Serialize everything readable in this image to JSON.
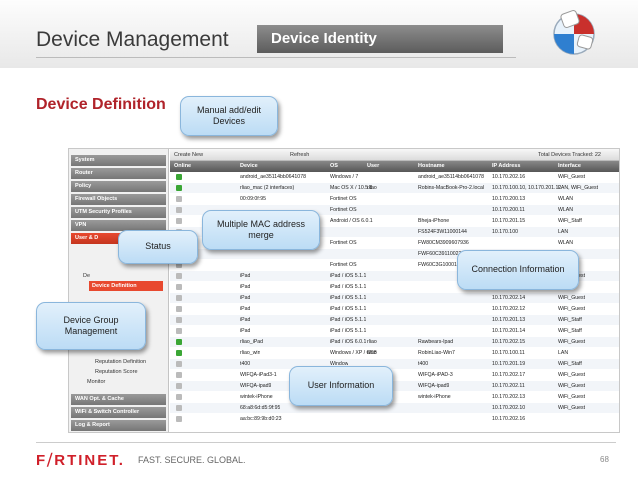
{
  "header": {
    "title": "Device Management",
    "tab": "Device Identity"
  },
  "subtitle": "Device Definition",
  "toolbar": {
    "create": "Create New",
    "refresh": "Refresh",
    "total": "Total Devices Tracked: 22"
  },
  "sidebar": {
    "sections": [
      "System",
      "Router",
      "Policy",
      "Firewall Objects",
      "UTM Security Profiles",
      "VPN",
      "User & D"
    ],
    "tree": [
      "De",
      "Device Definition",
      "Reputation Definition",
      "Reputation Score",
      "Monitor"
    ],
    "bottom": [
      "WAN Opt. & Cache",
      "WiFi & Switch Controller",
      "Log & Report"
    ]
  },
  "columns": [
    "Online",
    "Device",
    "OS",
    "User",
    "Hostname",
    "IP Address",
    "Interface"
  ],
  "rows": [
    [
      "android_ae35114bb0641078",
      "Windows / 7",
      "",
      "android_ae35114bb0641078",
      "10.170.202.16",
      "WiFi_Guest"
    ],
    [
      "rliao_mac (2 interfaces)",
      "Mac OS X / 10.5.8",
      "rliao",
      "Robins-MacBook-Pro-2.local",
      "10.170.100.10, 10.170.201.12",
      "LAN, WiFi_Guest"
    ],
    [
      "00:09:0f:95",
      "Fortinet OS",
      "",
      "",
      "10.170.200.13",
      "WLAN"
    ],
    [
      "",
      "Fortinet OS",
      "",
      "",
      "10.170.200.11",
      "WLAN"
    ],
    [
      "",
      "Android / OS 6.0.1",
      "",
      "Bheja-iPhone",
      "10.170.201.15",
      "WiFi_Staff"
    ],
    [
      "",
      "",
      "",
      "FS524F3W11000144",
      "10.170.100",
      "LAN"
    ],
    [
      "",
      "Fortinet OS",
      "",
      "FW80CM3909607936",
      "",
      "WLAN"
    ],
    [
      "",
      "",
      "",
      "FWF60C3911002282",
      "",
      "LAN"
    ],
    [
      "",
      "Fortinet OS",
      "",
      "FW60C3G10001095",
      "",
      "LAN"
    ],
    [
      "iPad",
      "iPad / iOS 5.1.1",
      "",
      "",
      "",
      "WiFi_Guest"
    ],
    [
      "iPad",
      "iPad / iOS 5.1.1",
      "",
      "",
      "",
      ""
    ],
    [
      "iPad",
      "iPad / iOS 5.1.1",
      "",
      "",
      "10.170.202.14",
      "WiFi_Guest"
    ],
    [
      "iPad",
      "iPad / iOS 5.1.1",
      "",
      "",
      "10.170.202.12",
      "WiFi_Guest"
    ],
    [
      "iPad",
      "iPad / iOS 5.1.1",
      "",
      "",
      "10.170.201.13",
      "WiFi_Staff"
    ],
    [
      "iPad",
      "iPad / iOS 5.1.1",
      "",
      "",
      "10.170.201.14",
      "WiFi_Staff"
    ],
    [
      "rliao_iPad",
      "iPad / iOS 6.0.1",
      "rliao",
      "Rawbears-Ipad",
      "10.170.202.15",
      "WiFi_Guest"
    ],
    [
      "rliao_win",
      "Windows / XP / 6/98",
      "rliao",
      "RobinLiao-Win7",
      "10.170.100.11",
      "LAN"
    ],
    [
      "t400",
      "Window",
      "",
      "t400",
      "10.170.201.19",
      "WiFi_Staff"
    ],
    [
      "WIFQA-iPad3-1",
      "",
      "",
      "WIFQA-iPAD-3",
      "10.170.202.17",
      "WiFi_Guest"
    ],
    [
      "WIFQA-ipad9",
      "",
      "",
      "WIFQA-ipad9",
      "10.170.202.11",
      "WiFi_Guest"
    ],
    [
      "wintek-iPhone",
      "",
      "",
      "wintek-iPhone",
      "10.170.202.13",
      "WiFi_Guest"
    ],
    [
      "68:a8:6d:d5:9f:95",
      "",
      "",
      "",
      "10.170.202.10",
      "WiFi_Guest"
    ],
    [
      "aa:bc:89:9b:d0:23",
      "",
      "",
      "",
      "10.170.202.16",
      ""
    ]
  ],
  "callouts": {
    "manual": "Manual add/edit Devices",
    "status": "Status",
    "mac": "Multiple MAC address merge",
    "connection": "Connection Information",
    "group": "Device Group Management",
    "user": "User Information"
  },
  "footer": {
    "brand": "F⧸RTINET.",
    "tagline": "FAST. SECURE. GLOBAL.",
    "page": "68"
  },
  "colors": {
    "accent": "#b0232a",
    "callout": "#cfe6f8",
    "selected": "#e8492f"
  }
}
